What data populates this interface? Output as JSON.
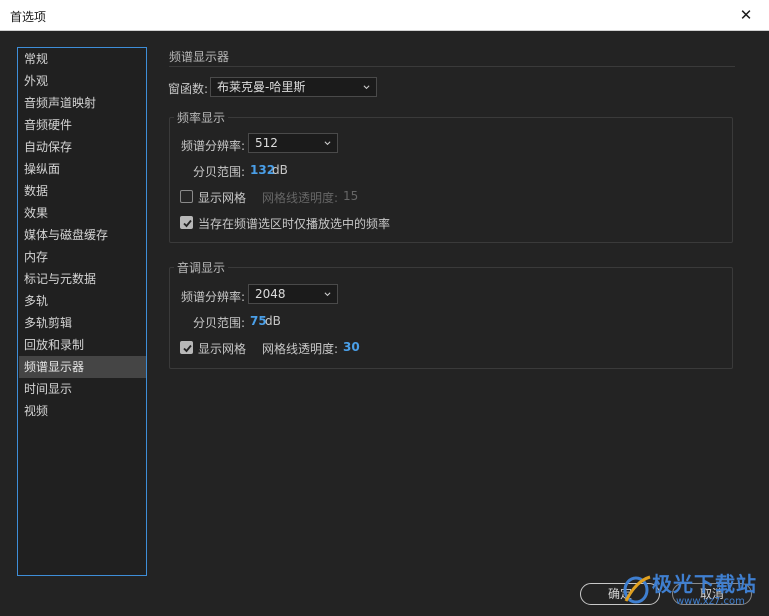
{
  "window": {
    "title": "首选项",
    "close_glyph": "✕"
  },
  "sidebar": {
    "items": [
      {
        "label": "常规"
      },
      {
        "label": "外观"
      },
      {
        "label": "音频声道映射"
      },
      {
        "label": "音频硬件"
      },
      {
        "label": "自动保存"
      },
      {
        "label": "操纵面"
      },
      {
        "label": "数据"
      },
      {
        "label": "效果"
      },
      {
        "label": "媒体与磁盘缓存"
      },
      {
        "label": "内存"
      },
      {
        "label": "标记与元数据"
      },
      {
        "label": "多轨"
      },
      {
        "label": "多轨剪辑"
      },
      {
        "label": "回放和录制"
      },
      {
        "label": "频谱显示器"
      },
      {
        "label": "时间显示"
      },
      {
        "label": "视频"
      }
    ],
    "selected": "频谱显示器"
  },
  "main": {
    "section_title": "频谱显示器",
    "window_function": {
      "label": "窗函数:",
      "value": "布莱克曼-哈里斯"
    },
    "frequency": {
      "title": "频率显示",
      "resolution": {
        "label": "频谱分辨率:",
        "value": "512"
      },
      "db_range": {
        "label": "分贝范围:",
        "value": "132",
        "unit": "dB"
      },
      "show_grid": {
        "label": "显示网格",
        "checked": false
      },
      "grid_opacity": {
        "label": "网格线透明度:",
        "value": "15",
        "enabled": false
      },
      "play_selection": {
        "label": "当存在频谱选区时仅播放选中的频率",
        "checked": true
      }
    },
    "pitch": {
      "title": "音调显示",
      "resolution": {
        "label": "频谱分辨率:",
        "value": "2048"
      },
      "db_range": {
        "label": "分贝范围:",
        "value": "75",
        "unit": "dB"
      },
      "show_grid": {
        "label": "显示网格",
        "checked": true
      },
      "grid_opacity": {
        "label": "网格线透明度:",
        "value": "30",
        "enabled": true
      }
    }
  },
  "footer": {
    "ok_label": "确定",
    "cancel_label": "取消"
  },
  "watermark": {
    "text": "极光下载站",
    "sub": "www.xz7.com"
  },
  "colors": {
    "accent": "#3e8ed8",
    "value_blue": "#4a9fe8",
    "background": "#232323"
  }
}
